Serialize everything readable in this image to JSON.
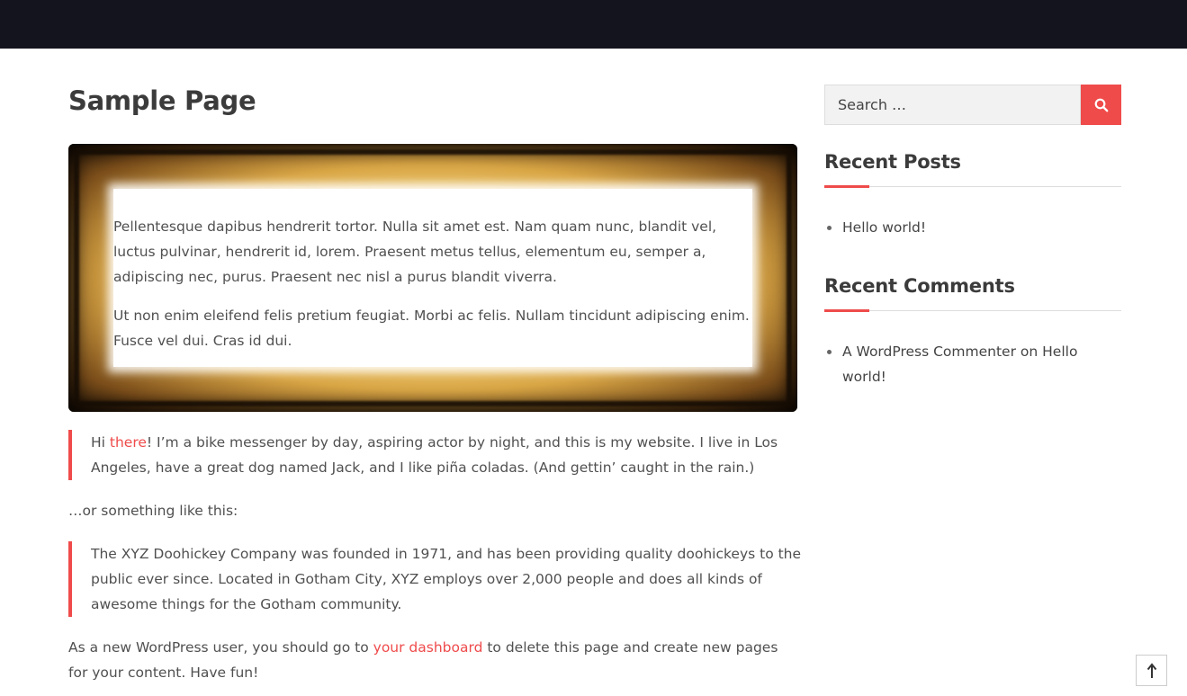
{
  "page": {
    "title": "Sample Page"
  },
  "grunge_box": {
    "paragraph1": "Pellentesque dapibus hendrerit tortor. Nulla sit amet est. Nam quam nunc, blandit vel, luctus pulvinar, hendrerit id, lorem. Praesent metus tellus, elementum eu, semper a, adipiscing nec, purus. Praesent nec nisl a purus blandit viverra.",
    "paragraph2": "Ut non enim eleifend felis pretium feugiat. Morbi ac felis. Nullam tincidunt adipiscing enim. Fusce vel dui. Cras id dui."
  },
  "quote1": {
    "prefix": "Hi ",
    "link": "there",
    "suffix": "! I’m a bike messenger by day, aspiring actor by night, and this is my website. I live in Los Angeles, have a great dog named Jack, and I like piña coladas. (And gettin’ caught in the rain.)"
  },
  "or_text": "…or something like this:",
  "quote2": {
    "text": "The XYZ Doohickey Company was founded in 1971, and has been providing quality doohickeys to the public ever since. Located in Gotham City, XYZ employs over 2,000 people and does all kinds of awesome things for the Gotham community."
  },
  "closing": {
    "prefix": "As a new WordPress user, you should go to ",
    "link": "your dashboard",
    "suffix": " to delete this page and create new pages for your content. Have fun!"
  },
  "sidebar": {
    "search": {
      "placeholder": "Search …",
      "value": ""
    },
    "recent_posts": {
      "title": "Recent Posts",
      "items": [
        "Hello world!"
      ]
    },
    "recent_comments": {
      "title": "Recent Comments",
      "items": [
        {
          "author": "A WordPress Commenter",
          "on": "on",
          "post": "Hello world!"
        }
      ]
    }
  },
  "icons": {
    "search": "search-icon",
    "scroll_top": "arrow-up-icon"
  },
  "colors": {
    "accent": "#ef4b4b",
    "topbar": "#14141f"
  }
}
